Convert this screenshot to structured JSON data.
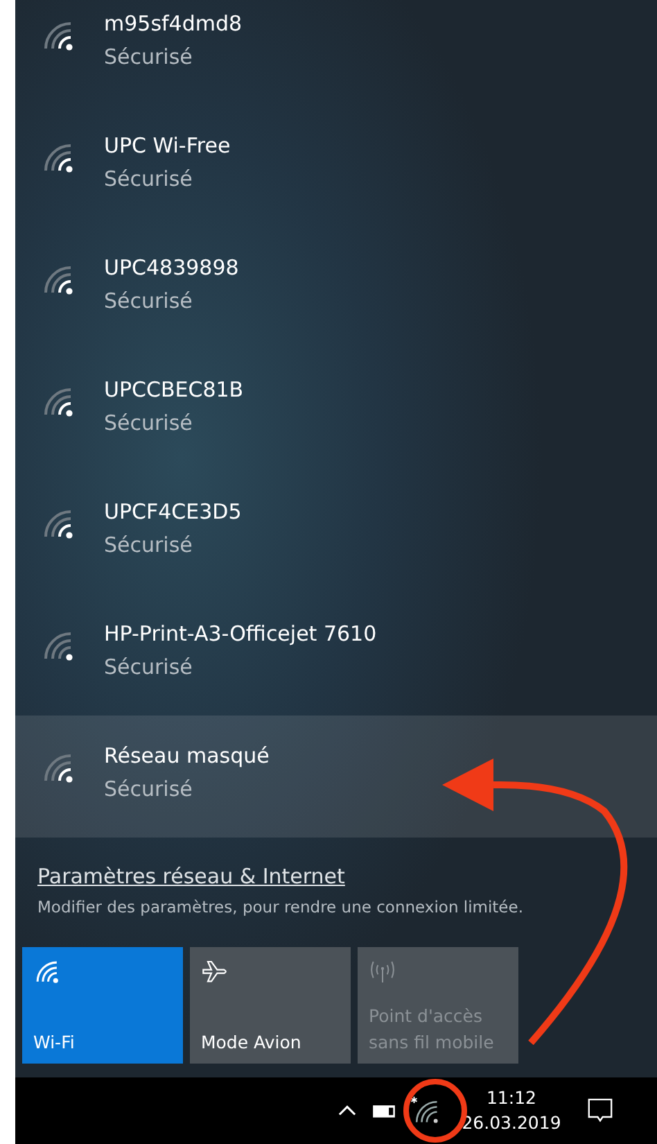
{
  "networks": [
    {
      "name": "m95sf4dmd8",
      "status": "Sécurisé",
      "weak_signal": false,
      "selected": false
    },
    {
      "name": "UPC Wi-Free",
      "status": "Sécurisé",
      "weak_signal": false,
      "selected": false
    },
    {
      "name": "UPC4839898",
      "status": "Sécurisé",
      "weak_signal": false,
      "selected": false
    },
    {
      "name": "UPCCBEC81B",
      "status": "Sécurisé",
      "weak_signal": false,
      "selected": false
    },
    {
      "name": "UPCF4CE3D5",
      "status": "Sécurisé",
      "weak_signal": false,
      "selected": false
    },
    {
      "name": "HP-Print-A3-Officejet 7610",
      "status": "Sécurisé",
      "weak_signal": true,
      "selected": false
    },
    {
      "name": "Réseau masqué",
      "status": "Sécurisé",
      "weak_signal": false,
      "selected": true
    }
  ],
  "settings": {
    "link": "Paramètres réseau & Internet",
    "description": "Modifier des paramètres, pour rendre une connexion limitée."
  },
  "tiles": [
    {
      "kind": "wifi",
      "label": "Wi-Fi",
      "on": true,
      "disabled": false
    },
    {
      "kind": "airplane",
      "label": "Mode Avion",
      "on": false,
      "disabled": false
    },
    {
      "kind": "hotspot",
      "label": "Point d'accès sans fil mobile",
      "on": false,
      "disabled": true
    }
  ],
  "taskbar": {
    "time": "11:12",
    "date": "26.03.2019"
  },
  "annotations": {
    "arrow": true,
    "circle": true
  }
}
